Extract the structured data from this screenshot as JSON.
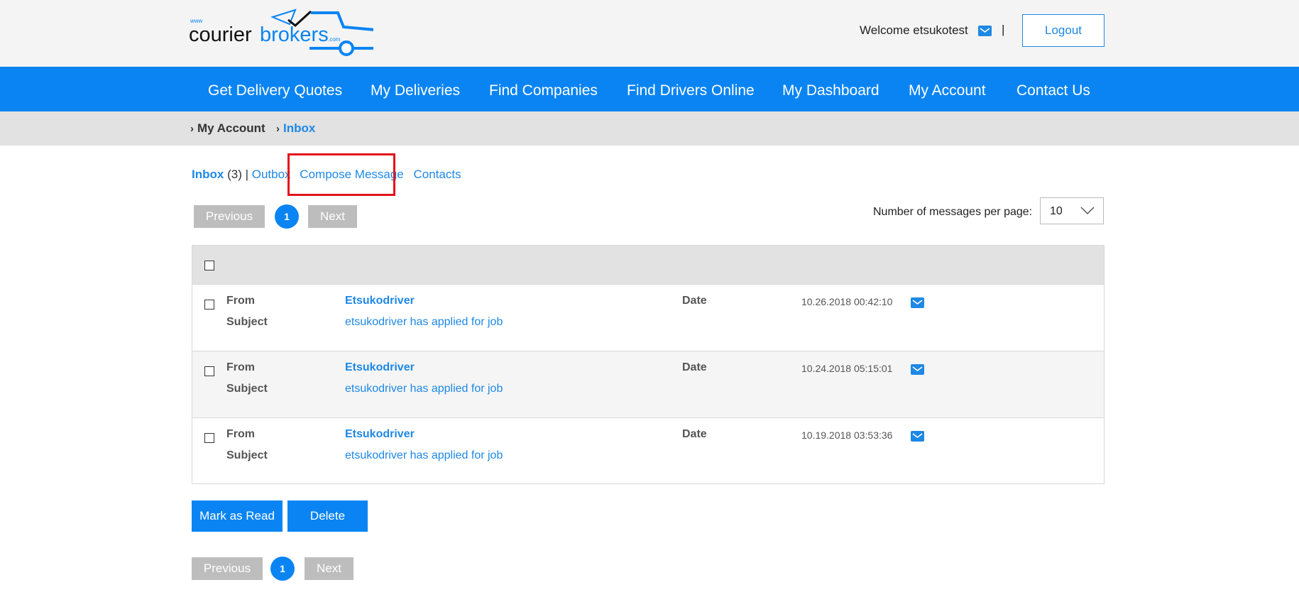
{
  "header": {
    "logo_text": "www courierbrokers.com",
    "welcome": "Welcome etsukotest",
    "mail_icon": "envelope-icon",
    "separator": "|",
    "logout_label": "Logout"
  },
  "nav": {
    "items": [
      {
        "label": "Get Delivery Quotes"
      },
      {
        "label": "My Deliveries"
      },
      {
        "label": "Find Companies"
      },
      {
        "label": "Find Drivers Online"
      },
      {
        "label": "My Dashboard"
      },
      {
        "label": "My Account"
      },
      {
        "label": "Contact Us"
      }
    ]
  },
  "breadcrumb": {
    "items": [
      {
        "label": "My Account"
      },
      {
        "label": "Inbox"
      }
    ]
  },
  "tabs": {
    "inbox": "Inbox",
    "inbox_count": "(3)",
    "sep": "|",
    "outbox": "Outbox",
    "compose": "Compose Message",
    "contacts": "Contacts"
  },
  "pagination": {
    "previous": "Previous",
    "current_page": "1",
    "next": "Next"
  },
  "per_page": {
    "label": "Number of messages per page:",
    "value": "10"
  },
  "messages": [
    {
      "from_label": "From",
      "from": "Etsukodriver",
      "subject_label": "Subject",
      "subject": "etsukodriver has applied for job",
      "date_label": "Date",
      "date": "10.26.2018 00:42:10"
    },
    {
      "from_label": "From",
      "from": "Etsukodriver",
      "subject_label": "Subject",
      "subject": "etsukodriver has applied for job",
      "date_label": "Date",
      "date": "10.24.2018 05:15:01"
    },
    {
      "from_label": "From",
      "from": "Etsukodriver",
      "subject_label": "Subject",
      "subject": "etsukodriver has applied for job",
      "date_label": "Date",
      "date": "10.19.2018 03:53:36"
    }
  ],
  "actions": {
    "mark_read": "Mark as Read",
    "delete": "Delete"
  },
  "colors": {
    "brand_blue": "#0a84f3",
    "link_blue": "#1e88e5",
    "highlight_red": "#e3121a"
  }
}
